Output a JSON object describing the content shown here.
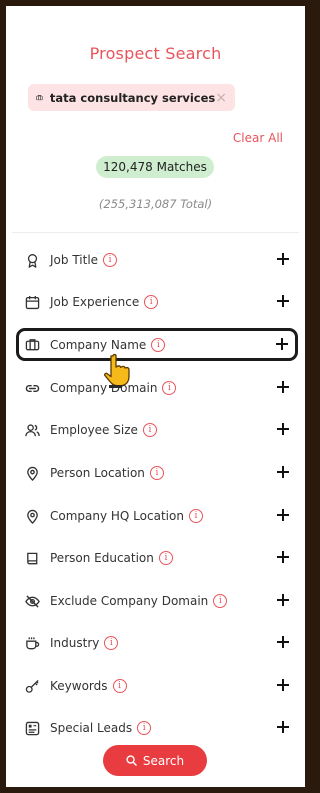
{
  "title": "Prospect Search",
  "chip": {
    "label": "tata consultancy services",
    "remove_symbol": "×"
  },
  "clear_all": "Clear All",
  "matches": "120,478 Matches",
  "total": "(255,313,087 Total)",
  "filters": [
    {
      "label": "Job Title",
      "icon": "ribbon-icon"
    },
    {
      "label": "Job Experience",
      "icon": "calendar-icon"
    },
    {
      "label": "Company Name",
      "icon": "briefcase-icon",
      "highlighted": true
    },
    {
      "label": "Company Domain",
      "icon": "link-icon"
    },
    {
      "label": "Employee Size",
      "icon": "users-icon"
    },
    {
      "label": "Person Location",
      "icon": "location-pin-icon"
    },
    {
      "label": "Company HQ Location",
      "icon": "location-pin-icon"
    },
    {
      "label": "Person Education",
      "icon": "book-icon"
    },
    {
      "label": "Exclude Company Domain",
      "icon": "eye-off-icon"
    },
    {
      "label": "Industry",
      "icon": "cup-icon"
    },
    {
      "label": "Keywords",
      "icon": "key-icon"
    },
    {
      "label": "Special Leads",
      "icon": "badge-icon"
    }
  ],
  "info_symbol": "i",
  "search_button": "Search",
  "colors": {
    "accent": "#e8555a",
    "button": "#e83c40",
    "chip_bg": "#fde3e3",
    "matches_bg": "#cfeecf"
  }
}
